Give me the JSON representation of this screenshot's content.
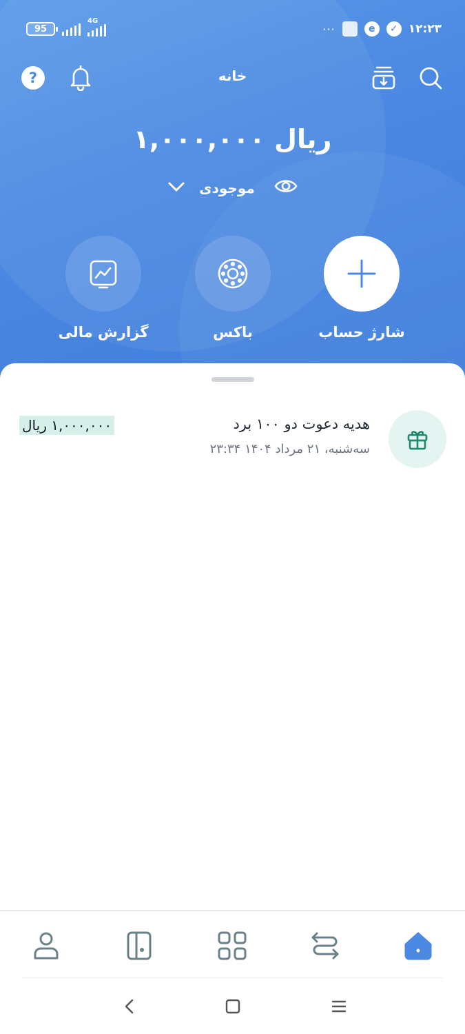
{
  "status_bar": {
    "battery": "95",
    "network": "4G",
    "time": "۱۲:۲۳",
    "dots": "···"
  },
  "header": {
    "title": "خانه"
  },
  "balance": {
    "amount": "۱,۰۰۰,۰۰۰ ریال",
    "label": "موجودی"
  },
  "actions": [
    {
      "label": "شارژ حساب",
      "icon": "plus-icon"
    },
    {
      "label": "باکس",
      "icon": "box-icon"
    },
    {
      "label": "گزارش مالی",
      "icon": "chart-icon"
    }
  ],
  "transactions": [
    {
      "title": "هدیه دعوت دو ۱۰۰ برد",
      "date": "سه‌شنبه، ۲۱ مرداد ۱۴۰۴ ۲۳:۳۴",
      "amount": "۱,۰۰۰,۰۰۰ ریال",
      "icon": "gift-icon"
    }
  ],
  "bottom_nav": [
    "home-icon",
    "transfer-icon",
    "services-icon",
    "cards-icon",
    "profile-icon"
  ],
  "colors": {
    "primary": "#4a88e2",
    "nav_icon": "#6b8189",
    "gift_bg": "#e4f5f1",
    "gift_icon": "#1b8a6e",
    "amount_highlight": "#d7efe9"
  }
}
